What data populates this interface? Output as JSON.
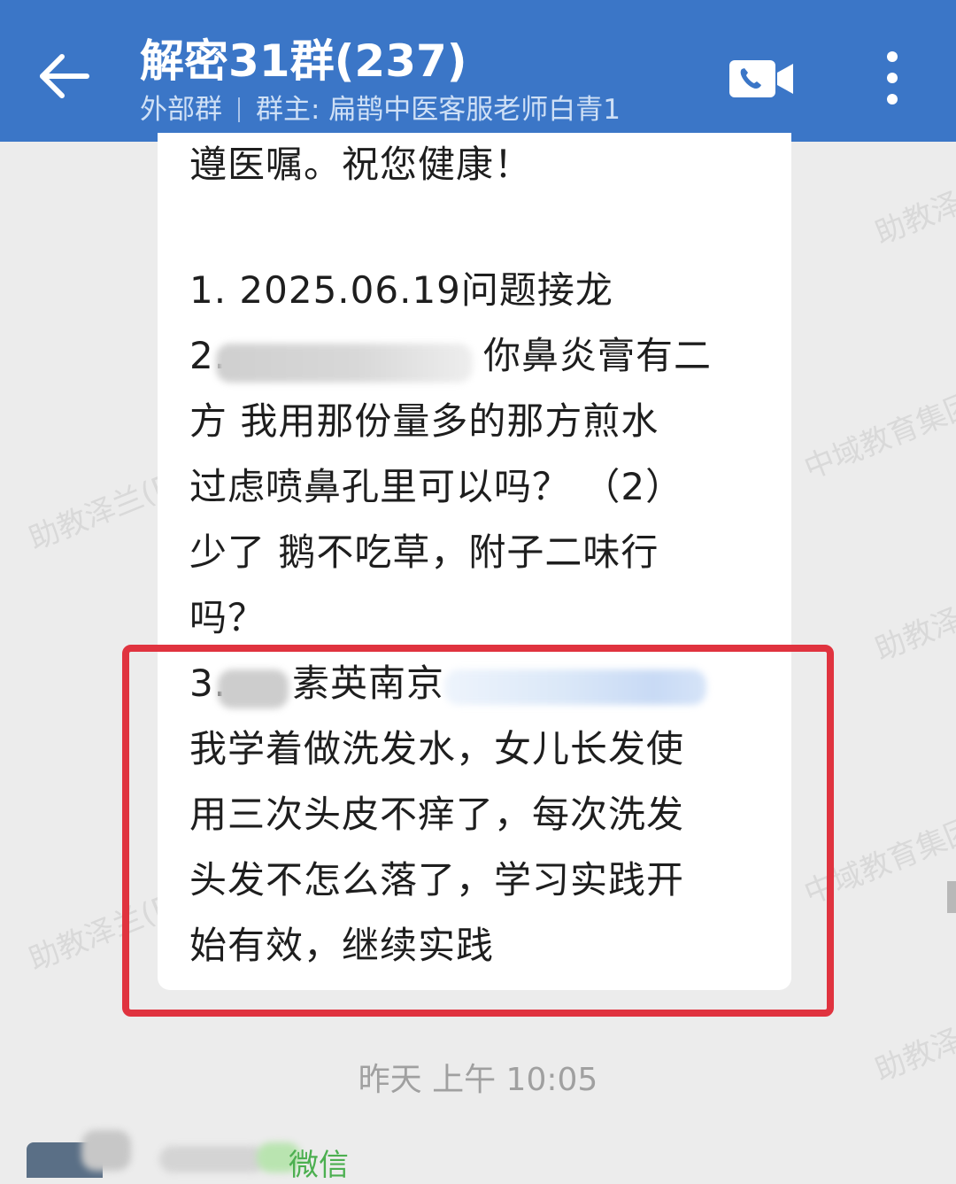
{
  "header": {
    "title": "解密31群(237)",
    "group_type": "外部群",
    "owner": "群主: 扁鹊中医客服老师白青1"
  },
  "message": {
    "lines": [
      "遵医嘱。祝您健康！",
      "1. 2025.06.19问题接龙",
      "2.",
      "你鼻炎膏有二",
      "方  我用那份量多的那方煎水",
      "过虑喷鼻孔里可以吗？ （2）",
      "少了 鹅不吃草，附子二味行",
      "吗？",
      "3.",
      "素英南京",
      "我学着做洗发水，女儿长发使",
      "用三次头皮不痒了，每次洗发",
      "头发不怎么落了，学习实践开",
      "始有效，继续实践"
    ]
  },
  "watermarks": [
    "助教泽",
    "中域教育集团",
    "助教泽兰(F",
    "助教泽",
    "中域教育集团",
    "助教泽兰(F",
    "助教泽"
  ],
  "timestamp": "昨天  上午 10:05",
  "next_message": {
    "sender": "微信"
  },
  "colors": {
    "header_bg": "#3b76c7",
    "highlight_border": "#e0333f",
    "chat_bg": "#ececec"
  }
}
